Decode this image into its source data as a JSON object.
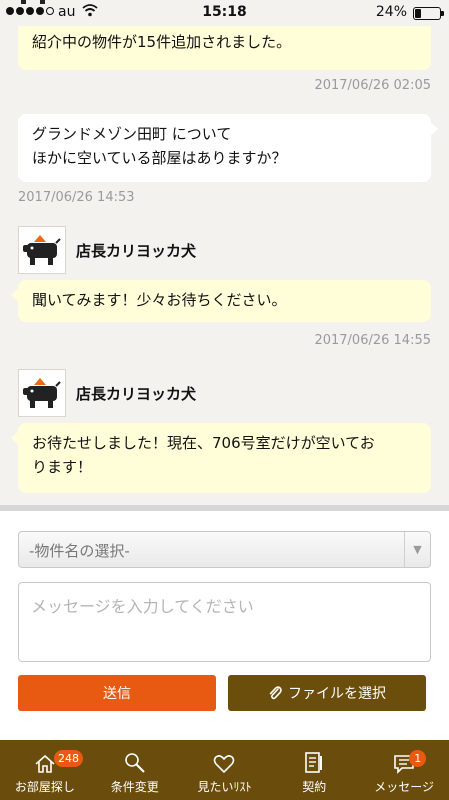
{
  "status_bar": {
    "carrier": "au",
    "time": "15:18",
    "battery": "24%",
    "battery_level": 0.24
  },
  "messages": [
    {
      "side": "left",
      "text": "紹介中の物件が15件追加されました。",
      "timestamp": "2017/06/26 02:05"
    },
    {
      "side": "right",
      "lines": [
        "グランドメゾン田町 について",
        "ほかに空いている部屋はありますか？"
      ],
      "timestamp": "2017/06/26 14:53"
    },
    {
      "side": "left",
      "sender": "店長カリヨッカ犬",
      "text": "聞いてみます！少々お待ちください。",
      "timestamp": "2017/06/26 14:55"
    },
    {
      "side": "left",
      "sender": "店長カリヨッカ犬",
      "lines": [
        "お待たせしました！現在、706号室だけが空いてお",
        "ります！"
      ]
    }
  ],
  "form": {
    "select_value": "-物件名の選択-",
    "message_placeholder": "メッセージを入力してください",
    "send_label": "送信",
    "file_label": "ファイルを選択"
  },
  "nav": {
    "items": [
      {
        "label": "お部屋探し",
        "icon": "house-icon",
        "badge": "248"
      },
      {
        "label": "条件変更",
        "icon": "search-icon"
      },
      {
        "label": "見たいﾘｽﾄ",
        "icon": "heart-icon"
      },
      {
        "label": "契約",
        "icon": "document-icon"
      },
      {
        "label": "メッセージ",
        "icon": "chat-icon",
        "badge": "1"
      }
    ]
  },
  "colors": {
    "accent": "#e85a12",
    "brand": "#6a4d0c",
    "bubble": "#fffed9",
    "background": "#f3f2ee"
  }
}
